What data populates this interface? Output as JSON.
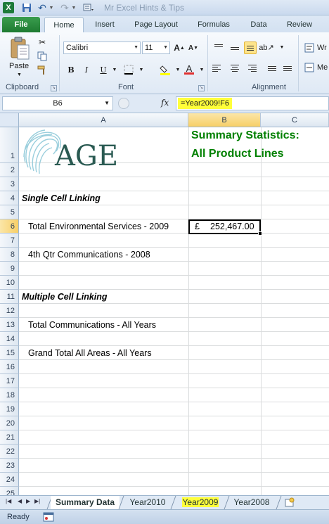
{
  "window": {
    "title": "Mr Excel Hints & Tips"
  },
  "tabs": [
    "File",
    "Home",
    "Insert",
    "Page Layout",
    "Formulas",
    "Data",
    "Review"
  ],
  "ribbon": {
    "paste_label": "Paste",
    "font_name": "Calibri",
    "font_size": "11",
    "groups": {
      "clipboard": "Clipboard",
      "font": "Font",
      "alignment": "Alignment"
    },
    "wrap_label": "Wr",
    "merge_label": "Me"
  },
  "formula_bar": {
    "name_box": "B6",
    "fx": "fx",
    "formula": "=Year2009!F6"
  },
  "columns": [
    "A",
    "B",
    "C"
  ],
  "rows": [
    "1",
    "2",
    "3",
    "4",
    "5",
    "6",
    "7",
    "8",
    "9",
    "10",
    "11",
    "12",
    "13",
    "14",
    "15",
    "16",
    "17",
    "18",
    "19",
    "20",
    "21",
    "22",
    "23",
    "24",
    "25"
  ],
  "cells": {
    "b1_line1": "Summary Statistics:",
    "b1_line2": "All Product Lines",
    "logo_text": "AGE",
    "a4": "Single Cell Linking",
    "a6": "Total Environmental Services - 2009",
    "b6_currency": "£",
    "b6_value": "252,467.00",
    "a8": "4th Qtr Communications - 2008",
    "a11": "Multiple Cell Linking",
    "a13": "Total Communications - All Years",
    "a15": "Grand Total All Areas - All Years"
  },
  "sheets": [
    "Summary Data",
    "Year2010",
    "Year2009",
    "Year2008"
  ],
  "status": {
    "mode": "Ready"
  },
  "colors": {
    "accent_green": "#008000",
    "highlight_yellow": "#ffff3a",
    "file_tab": "#1e7b31"
  }
}
